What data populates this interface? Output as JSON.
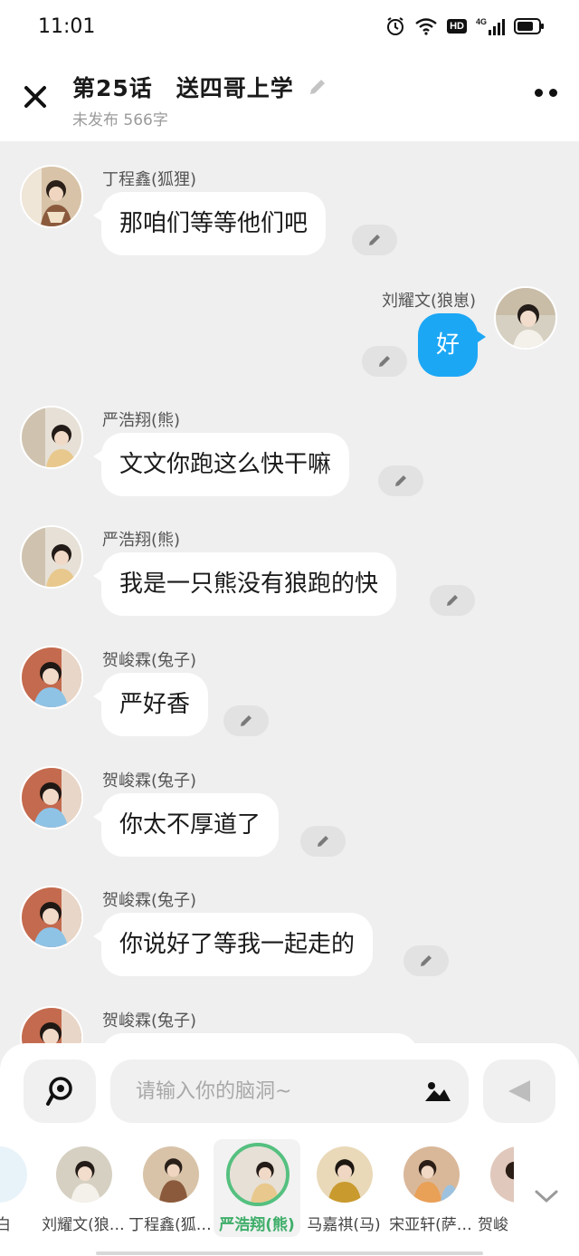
{
  "status_bar": {
    "time": "11:01",
    "hd": "HD",
    "network": "4G"
  },
  "header": {
    "title": "第25话　送四哥上学",
    "subtitle": "未发布 566字"
  },
  "messages": [
    {
      "name": "丁程鑫(狐狸)",
      "text": "那咱们等等他们吧",
      "side": "left"
    },
    {
      "name": "刘耀文(狼崽)",
      "text": "好",
      "side": "right"
    },
    {
      "name": "严浩翔(熊)",
      "text": "文文你跑这么快干嘛",
      "side": "left"
    },
    {
      "name": "严浩翔(熊)",
      "text": "我是一只熊没有狼跑的快",
      "side": "left"
    },
    {
      "name": "贺峻霖(兔子)",
      "text": "严好香",
      "side": "left"
    },
    {
      "name": "贺峻霖(兔子)",
      "text": "你太不厚道了",
      "side": "left"
    },
    {
      "name": "贺峻霖(兔子)",
      "text": "你说好了等我一起走的",
      "side": "left"
    },
    {
      "name": "贺峻霖(兔子)",
      "text": "",
      "side": "left"
    }
  ],
  "input": {
    "placeholder": "请输入你的脑洞~"
  },
  "characters": [
    {
      "label": "白",
      "selected": false
    },
    {
      "label": "刘耀文(狼…",
      "selected": false
    },
    {
      "label": "丁程鑫(狐…",
      "selected": false
    },
    {
      "label": "严浩翔(熊)",
      "selected": true
    },
    {
      "label": "马嘉祺(马)",
      "selected": false
    },
    {
      "label": "宋亚轩(萨…",
      "selected": false
    },
    {
      "label": "贺峻",
      "selected": false
    }
  ],
  "colors": {
    "bubble_right": "#1ca7f5",
    "selected_char": "#55c07f",
    "background": "#efefef"
  },
  "icons": [
    "close-icon",
    "pencil-icon",
    "more-icon",
    "voice-icon",
    "image-icon",
    "send-icon",
    "chevron-down-icon"
  ]
}
